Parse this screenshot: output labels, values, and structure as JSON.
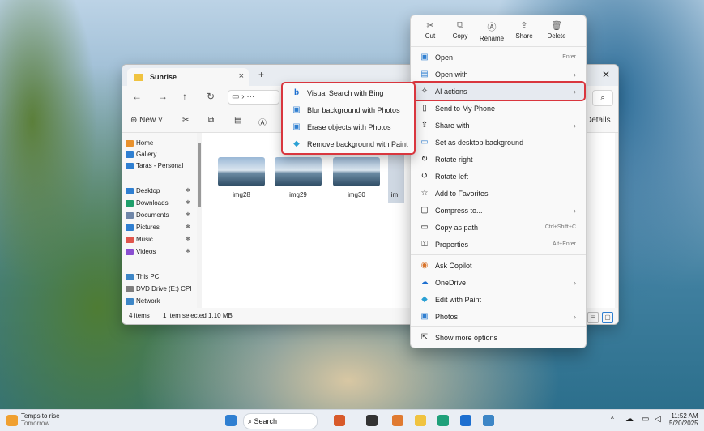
{
  "explorer": {
    "tab_title": "Sunrise",
    "tab_close": "×",
    "new_tab": "+",
    "window_close": "✕",
    "nav": {
      "back": "←",
      "forward": "→",
      "up": "↑",
      "refresh": "↻",
      "more": "···"
    },
    "search_icon": "⌕",
    "command_bar": {
      "new": "New",
      "details": "Details"
    },
    "sidebar": {
      "items": [
        {
          "label": "Home",
          "color": "#e8912d"
        },
        {
          "label": "Gallery",
          "color": "#2f7fd1"
        },
        {
          "label": "Taras - Personal",
          "color": "#2f7fd1"
        },
        {
          "label": "Desktop",
          "color": "#2f7fd1"
        },
        {
          "label": "Downloads",
          "color": "#1e9f6a"
        },
        {
          "label": "Documents",
          "color": "#6f86a8"
        },
        {
          "label": "Pictures",
          "color": "#2f7fd1"
        },
        {
          "label": "Music",
          "color": "#e0554c"
        },
        {
          "label": "Videos",
          "color": "#8a4fd1"
        },
        {
          "label": "This PC",
          "color": "#3d86c6"
        },
        {
          "label": "DVD Drive (E:) CPI",
          "color": "#7d7d7d"
        },
        {
          "label": "Network",
          "color": "#3d86c6"
        }
      ]
    },
    "files": [
      {
        "name": "img28"
      },
      {
        "name": "img29"
      },
      {
        "name": "img30"
      },
      {
        "name": "im"
      }
    ],
    "status": {
      "items": "4 items",
      "selected": "1 item selected 1.10 MB"
    }
  },
  "context_menu": {
    "quick_actions": [
      {
        "label": "Cut",
        "icon": "scissors-icon",
        "glyph": "✂"
      },
      {
        "label": "Copy",
        "icon": "copy-icon",
        "glyph": "⧉"
      },
      {
        "label": "Rename",
        "icon": "rename-icon",
        "glyph": "Ⓐ"
      },
      {
        "label": "Share",
        "icon": "share-icon",
        "glyph": "⇪"
      },
      {
        "label": "Delete",
        "icon": "trash-icon",
        "glyph": "🗑"
      }
    ],
    "items": [
      {
        "label": "Open",
        "shortcut": "Enter",
        "glyph": "▣",
        "color": "#2f7fd1"
      },
      {
        "label": "Open with",
        "arrow": "›",
        "glyph": "▤",
        "color": "#2f7fd1"
      },
      {
        "label": "AI actions",
        "arrow": "›",
        "glyph": "✧",
        "color": "#444"
      },
      {
        "label": "Send to My Phone",
        "glyph": "▯",
        "color": "#444"
      },
      {
        "label": "Share with",
        "arrow": "›",
        "glyph": "⇪",
        "color": "#444"
      },
      {
        "label": "Set as desktop background",
        "glyph": "▭",
        "color": "#2f7fd1"
      },
      {
        "label": "Rotate right",
        "glyph": "↻",
        "color": "#444"
      },
      {
        "label": "Rotate left",
        "glyph": "↺",
        "color": "#444"
      },
      {
        "label": "Add to Favorites",
        "glyph": "☆",
        "color": "#444"
      },
      {
        "label": "Compress to...",
        "arrow": "›",
        "glyph": "▢",
        "color": "#444"
      },
      {
        "label": "Copy as path",
        "shortcut": "Ctrl+Shift+C",
        "glyph": "▭",
        "color": "#444"
      },
      {
        "label": "Properties",
        "shortcut": "Alt+Enter",
        "glyph": "⚿",
        "color": "#444"
      },
      {
        "label": "Ask Copilot",
        "glyph": "◉",
        "color": "#d8742c"
      },
      {
        "label": "OneDrive",
        "arrow": "›",
        "glyph": "☁",
        "color": "#1d6fd0"
      },
      {
        "label": "Edit with Paint",
        "glyph": "◆",
        "color": "#2aa0d4"
      },
      {
        "label": "Photos",
        "arrow": "›",
        "glyph": "▣",
        "color": "#2f7fd1"
      },
      {
        "label": "Show more options",
        "glyph": "⇱",
        "color": "#444"
      }
    ]
  },
  "ai_submenu": {
    "items": [
      {
        "label": "Visual Search with Bing",
        "glyph": "b",
        "color": "#1d6fd0"
      },
      {
        "label": "Blur background with Photos",
        "glyph": "▣",
        "color": "#2f7fd1"
      },
      {
        "label": "Erase objects with Photos",
        "glyph": "▣",
        "color": "#2f7fd1"
      },
      {
        "label": "Remove background with Paint",
        "glyph": "◆",
        "color": "#2aa0d4"
      }
    ]
  },
  "taskbar": {
    "weather_title": "Temps to rise",
    "weather_sub": "Tomorrow",
    "search": "Search",
    "time": "11:52 AM",
    "date": "5/20/2025",
    "tray": "^"
  }
}
